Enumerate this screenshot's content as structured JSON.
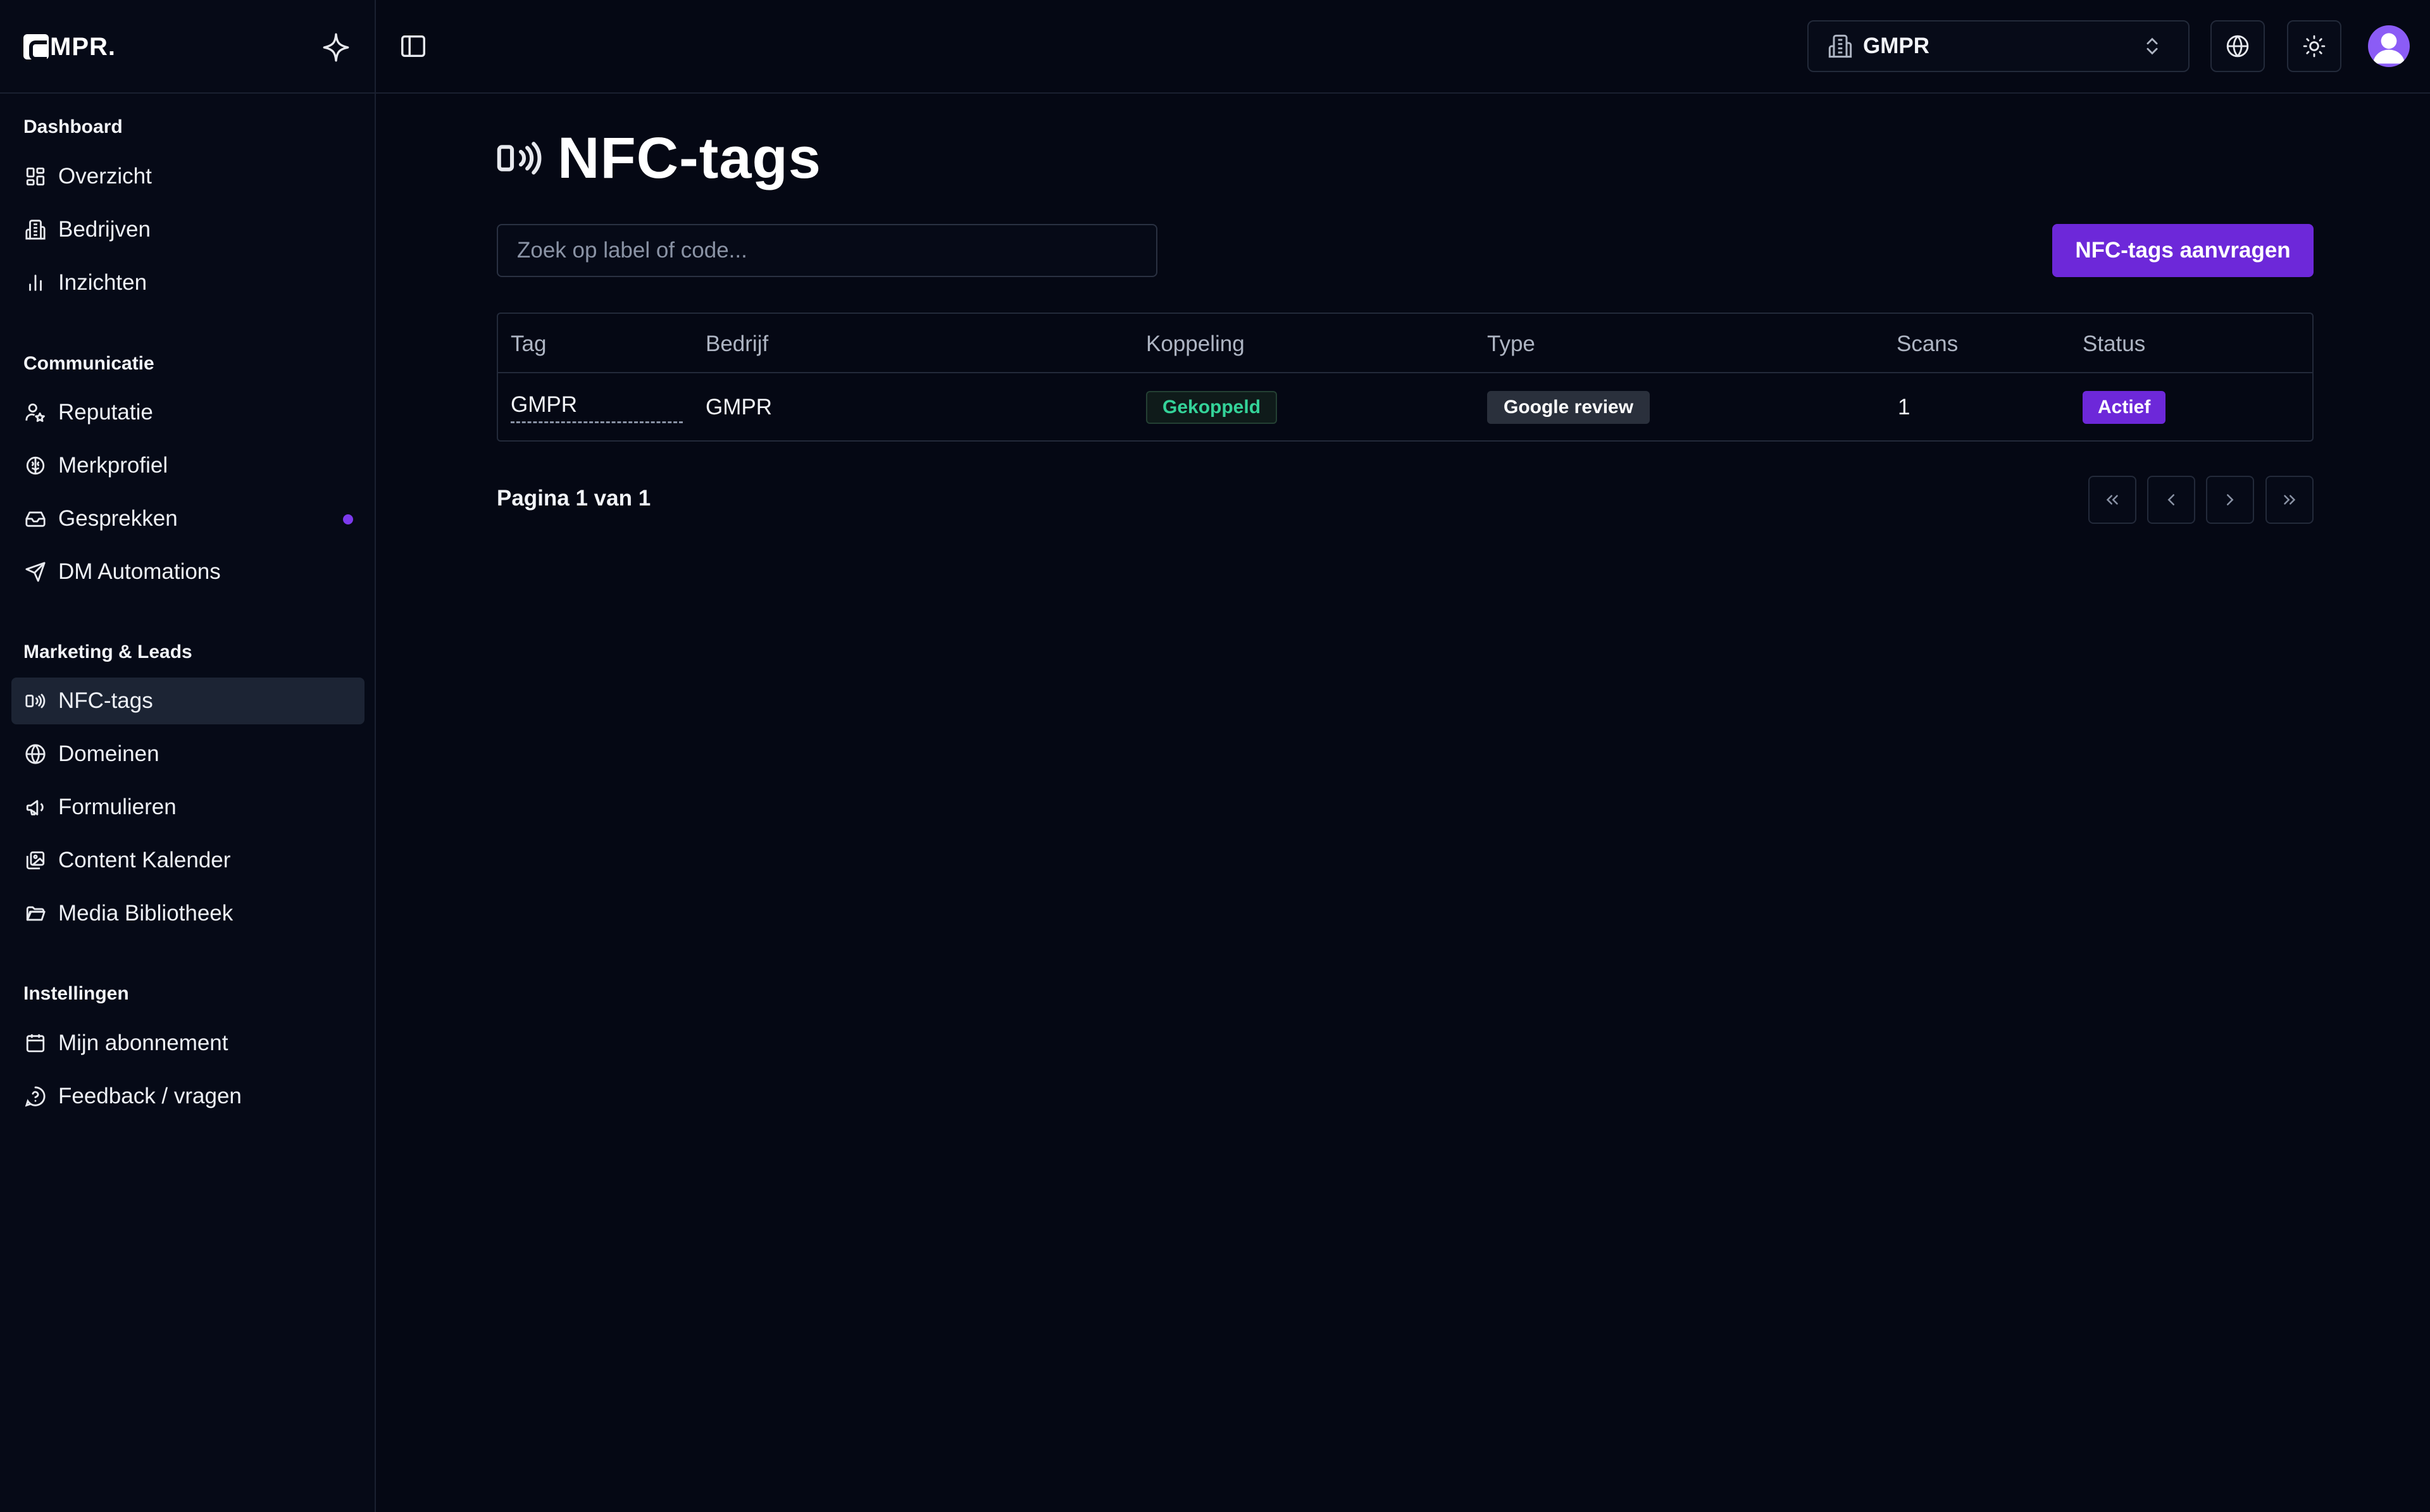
{
  "brand": {
    "logo_text": "MPR."
  },
  "sidebar": {
    "sections": [
      {
        "title": "Dashboard"
      },
      {
        "title": "Communicatie"
      },
      {
        "title": "Marketing & Leads"
      },
      {
        "title": "Instellingen"
      }
    ],
    "items": [
      {
        "label": "Overzicht",
        "icon": "dashboard-grid-icon"
      },
      {
        "label": "Bedrijven",
        "icon": "building-icon"
      },
      {
        "label": "Inzichten",
        "icon": "bar-chart-icon"
      },
      {
        "label": "Reputatie",
        "icon": "user-star-icon"
      },
      {
        "label": "Merkprofiel",
        "icon": "brain-icon"
      },
      {
        "label": "Gesprekken",
        "icon": "inbox-icon",
        "unread": true
      },
      {
        "label": "DM Automations",
        "icon": "send-icon"
      },
      {
        "label": "NFC-tags",
        "icon": "nfc-icon",
        "active": true
      },
      {
        "label": "Domeinen",
        "icon": "globe-icon"
      },
      {
        "label": "Formulieren",
        "icon": "megaphone-icon"
      },
      {
        "label": "Content Kalender",
        "icon": "image-stack-icon"
      },
      {
        "label": "Media Bibliotheek",
        "icon": "folder-icon"
      },
      {
        "label": "Mijn abonnement",
        "icon": "calendar-icon"
      },
      {
        "label": "Feedback / vragen",
        "icon": "help-circle-icon"
      }
    ]
  },
  "topbar": {
    "org_selector": {
      "value": "GMPR",
      "icon": "building-icon"
    }
  },
  "page": {
    "title": "NFC-tags",
    "search_placeholder": "Zoek op label of code...",
    "primary_button": "NFC-tags aanvragen"
  },
  "table": {
    "columns": [
      "Tag",
      "Bedrijf",
      "Koppeling",
      "Type",
      "Scans",
      "Status"
    ],
    "rows": [
      {
        "tag": "GMPR",
        "bedrijf": "GMPR",
        "koppeling": "Gekoppeld",
        "type": "Google review",
        "scans": "1",
        "status": "Actief"
      }
    ]
  },
  "pagination": {
    "label": "Pagina 1 van 1"
  },
  "colors": {
    "accent": "#6d28d9",
    "background": "#050814",
    "success": "#34d399"
  }
}
